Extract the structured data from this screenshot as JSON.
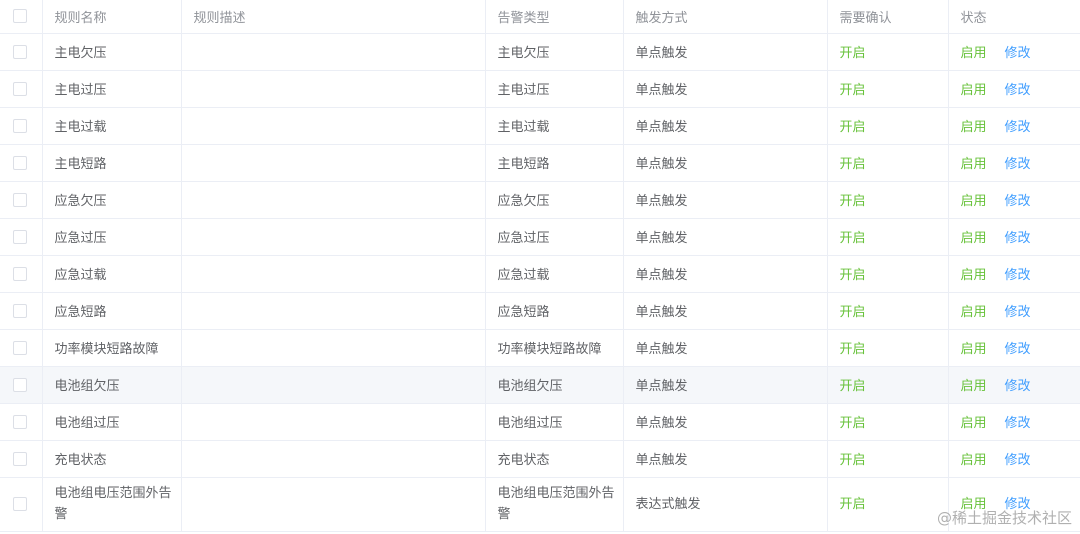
{
  "table": {
    "headers": {
      "name": "规则名称",
      "description": "规则描述",
      "alarm_type": "告警类型",
      "trigger": "触发方式",
      "confirm": "需要确认",
      "status": "状态"
    },
    "rows": [
      {
        "name": "主电欠压",
        "description": "",
        "alarm_type": "主电欠压",
        "trigger": "单点触发",
        "confirm": "开启",
        "enable": "启用",
        "edit": "修改"
      },
      {
        "name": "主电过压",
        "description": "",
        "alarm_type": "主电过压",
        "trigger": "单点触发",
        "confirm": "开启",
        "enable": "启用",
        "edit": "修改"
      },
      {
        "name": "主电过载",
        "description": "",
        "alarm_type": "主电过载",
        "trigger": "单点触发",
        "confirm": "开启",
        "enable": "启用",
        "edit": "修改"
      },
      {
        "name": "主电短路",
        "description": "",
        "alarm_type": "主电短路",
        "trigger": "单点触发",
        "confirm": "开启",
        "enable": "启用",
        "edit": "修改"
      },
      {
        "name": "应急欠压",
        "description": "",
        "alarm_type": "应急欠压",
        "trigger": "单点触发",
        "confirm": "开启",
        "enable": "启用",
        "edit": "修改"
      },
      {
        "name": "应急过压",
        "description": "",
        "alarm_type": "应急过压",
        "trigger": "单点触发",
        "confirm": "开启",
        "enable": "启用",
        "edit": "修改"
      },
      {
        "name": "应急过载",
        "description": "",
        "alarm_type": "应急过载",
        "trigger": "单点触发",
        "confirm": "开启",
        "enable": "启用",
        "edit": "修改"
      },
      {
        "name": "应急短路",
        "description": "",
        "alarm_type": "应急短路",
        "trigger": "单点触发",
        "confirm": "开启",
        "enable": "启用",
        "edit": "修改"
      },
      {
        "name": "功率模块短路故障",
        "description": "",
        "alarm_type": "功率模块短路故障",
        "trigger": "单点触发",
        "confirm": "开启",
        "enable": "启用",
        "edit": "修改"
      },
      {
        "name": "电池组欠压",
        "description": "",
        "alarm_type": "电池组欠压",
        "trigger": "单点触发",
        "confirm": "开启",
        "enable": "启用",
        "edit": "修改"
      },
      {
        "name": "电池组过压",
        "description": "",
        "alarm_type": "电池组过压",
        "trigger": "单点触发",
        "confirm": "开启",
        "enable": "启用",
        "edit": "修改"
      },
      {
        "name": "充电状态",
        "description": "",
        "alarm_type": "充电状态",
        "trigger": "单点触发",
        "confirm": "开启",
        "enable": "启用",
        "edit": "修改"
      },
      {
        "name": "电池组电压范围外告警",
        "description": "",
        "alarm_type": "电池组电压范围外告警",
        "trigger": "表达式触发",
        "confirm": "开启",
        "enable": "启用",
        "edit": "修改"
      }
    ]
  },
  "watermark": "@稀土掘金技术社区",
  "colors": {
    "confirm": "#67c23a",
    "enable": "#67c23a",
    "edit": "#409eff",
    "header_text": "#909399",
    "body_text": "#606266",
    "border": "#ebeef5",
    "hover_row": "#f5f7fa"
  }
}
